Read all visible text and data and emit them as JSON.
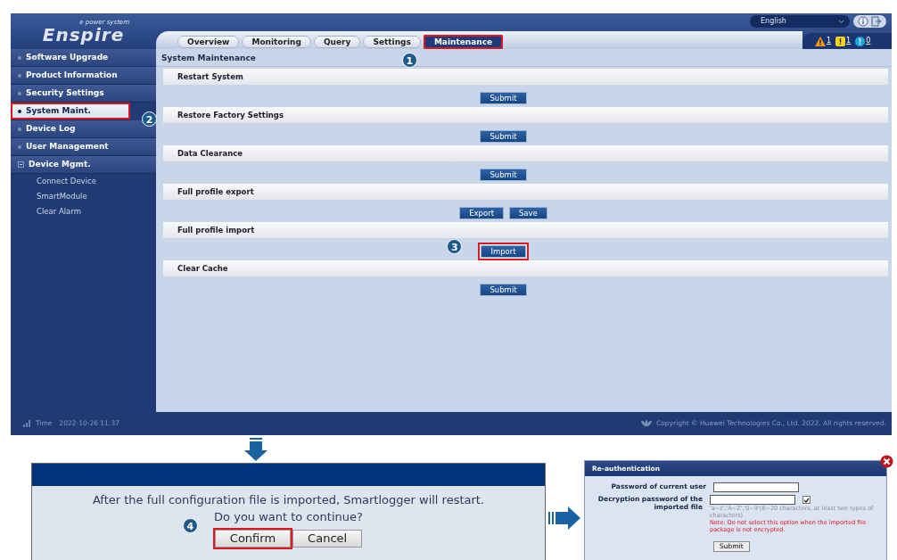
{
  "header": {
    "logo": {
      "name": "Enspire",
      "tagline": "e power system"
    },
    "language": "English",
    "alarms": [
      {
        "kind": "major",
        "count": "1"
      },
      {
        "kind": "minor",
        "count": "1"
      },
      {
        "kind": "warning",
        "count": "0"
      }
    ]
  },
  "tabs": [
    {
      "label": "Overview",
      "selected": false,
      "highlighted": false
    },
    {
      "label": "Monitoring",
      "selected": false,
      "highlighted": false
    },
    {
      "label": "Query",
      "selected": false,
      "highlighted": false
    },
    {
      "label": "Settings",
      "selected": false,
      "highlighted": false
    },
    {
      "label": "Maintenance",
      "selected": true,
      "highlighted": true,
      "callout": "1"
    }
  ],
  "sidebar": {
    "items": [
      {
        "label": "Software Upgrade",
        "selected": false,
        "highlighted": false,
        "expanded": false
      },
      {
        "label": "Product Information",
        "selected": false,
        "highlighted": false,
        "expanded": false
      },
      {
        "label": "Security Settings",
        "selected": false,
        "highlighted": false,
        "expanded": false
      },
      {
        "label": "System Maint.",
        "selected": true,
        "highlighted": true,
        "expanded": false,
        "callout": "2"
      },
      {
        "label": "Device Log",
        "selected": false,
        "highlighted": false,
        "expanded": false
      },
      {
        "label": "User Management",
        "selected": false,
        "highlighted": false,
        "expanded": false
      },
      {
        "label": "Device Mgmt.",
        "selected": false,
        "highlighted": false,
        "expanded": true,
        "children": [
          {
            "label": "Connect Device",
            "selected": false
          },
          {
            "label": "SmartModule",
            "selected": false
          },
          {
            "label": "Clear Alarm",
            "selected": false
          }
        ]
      }
    ]
  },
  "content": {
    "title": "System Maintenance",
    "sections": [
      {
        "title": "Restart System",
        "buttons": [
          {
            "label": "Submit",
            "highlighted": false
          }
        ]
      },
      {
        "title": "Restore Factory Settings",
        "buttons": [
          {
            "label": "Submit",
            "highlighted": false
          }
        ]
      },
      {
        "title": "Data Clearance",
        "buttons": [
          {
            "label": "Submit",
            "highlighted": false
          }
        ]
      },
      {
        "title": "Full profile export",
        "buttons": [
          {
            "label": "Export",
            "highlighted": false
          },
          {
            "label": "Save",
            "highlighted": false
          }
        ]
      },
      {
        "title": "Full profile import",
        "buttons": [
          {
            "label": "Import",
            "highlighted": true,
            "callout": "3"
          }
        ]
      },
      {
        "title": "Clear Cache",
        "buttons": [
          {
            "label": "Submit",
            "highlighted": false
          }
        ]
      }
    ]
  },
  "footer": {
    "time_label": "Time",
    "time": "2022-10-26 11:37",
    "copyright": "Copyright © Huawei Technologies Co., Ltd. 2022. All rights reserved."
  },
  "confirm_dialog": {
    "message": "After the full configuration file is imported, Smartlogger will restart. Do you want to continue?",
    "buttons": [
      {
        "label": "Confirm",
        "highlighted": true,
        "callout": "4"
      },
      {
        "label": "Cancel",
        "highlighted": false
      }
    ]
  },
  "reauth_dialog": {
    "title": "Re-authentication",
    "fields": [
      {
        "label": "Password of current user"
      },
      {
        "label": "Decryption password of the imported file",
        "checkbox": {
          "checked": true
        },
        "hint": "'a~z','A~Z','0~9'(8~20 characters, at least two types of characters)",
        "note": "Note: Do not select this option when the imported file package is not encrypted."
      }
    ],
    "submit": "Submit"
  }
}
